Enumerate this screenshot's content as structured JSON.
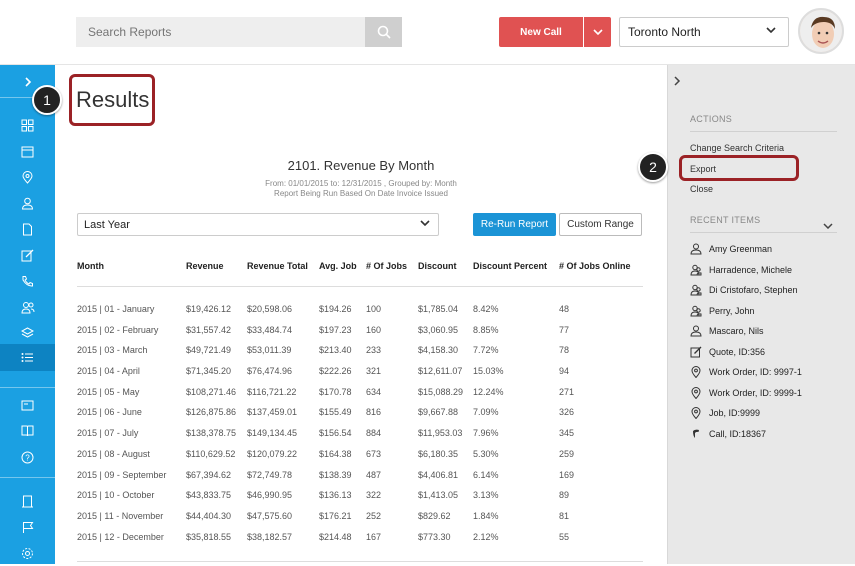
{
  "header": {
    "search_placeholder": "Search Reports",
    "new_call_label": "New Call",
    "location": "Toronto North"
  },
  "sidebar": {
    "icons": [
      "chevron-right-icon",
      "dashboard-icon",
      "calendar-icon",
      "location-pin-icon",
      "user-icon",
      "document-icon",
      "edit-icon",
      "phone-icon",
      "users-icon",
      "layers-icon",
      "list-icon",
      "id-card-icon",
      "book-icon",
      "help-icon",
      "building-icon",
      "flag-icon",
      "gear-icon"
    ]
  },
  "main": {
    "page_title": "Results",
    "callout_1": "1",
    "callout_2": "2",
    "report": {
      "title": "2101. Revenue By Month",
      "subtitle_line1": "From: 01/01/2015 to: 12/31/2015 , Grouped by: Month",
      "subtitle_line2": "Report Being Run Based On Date Invoice Issued"
    },
    "period_value": "Last Year",
    "rerun_label": "Re-Run Report",
    "custom_range_label": "Custom Range",
    "table": {
      "headers": [
        "Month",
        "Revenue",
        "Revenue Total",
        "Avg. Job",
        "# Of Jobs",
        "Discount",
        "Discount Percent",
        "# Of Jobs Online"
      ],
      "rows": [
        [
          "2015 | 01 - January",
          "$19,426.12",
          "$20,598.06",
          "$194.26",
          "100",
          "$1,785.04",
          "8.42%",
          "48"
        ],
        [
          "2015 | 02 - February",
          "$31,557.42",
          "$33,484.74",
          "$197.23",
          "160",
          "$3,060.95",
          "8.85%",
          "77"
        ],
        [
          "2015 | 03 - March",
          "$49,721.49",
          "$53,011.39",
          "$213.40",
          "233",
          "$4,158.30",
          "7.72%",
          "78"
        ],
        [
          "2015 | 04 - April",
          "$71,345.20",
          "$76,474.96",
          "$222.26",
          "321",
          "$12,611.07",
          "15.03%",
          "94"
        ],
        [
          "2015 | 05 - May",
          "$108,271.46",
          "$116,721.22",
          "$170.78",
          "634",
          "$15,088.29",
          "12.24%",
          "271"
        ],
        [
          "2015 | 06 - June",
          "$126,875.86",
          "$137,459.01",
          "$155.49",
          "816",
          "$9,667.88",
          "7.09%",
          "326"
        ],
        [
          "2015 | 07 - July",
          "$138,378.75",
          "$149,134.45",
          "$156.54",
          "884",
          "$11,953.03",
          "7.96%",
          "345"
        ],
        [
          "2015 | 08 - August",
          "$110,629.52",
          "$120,079.22",
          "$164.38",
          "673",
          "$6,180.35",
          "5.30%",
          "259"
        ],
        [
          "2015 | 09 - September",
          "$67,394.62",
          "$72,749.78",
          "$138.39",
          "487",
          "$4,406.81",
          "6.14%",
          "169"
        ],
        [
          "2015 | 10 - October",
          "$43,833.75",
          "$46,990.95",
          "$136.13",
          "322",
          "$1,413.05",
          "3.13%",
          "89"
        ],
        [
          "2015 | 11 - November",
          "$44,404.30",
          "$47,575.60",
          "$176.21",
          "252",
          "$829.62",
          "1.84%",
          "81"
        ],
        [
          "2015 | 12 - December",
          "$35,818.55",
          "$38,182.57",
          "$214.48",
          "167",
          "$773.30",
          "2.12%",
          "55"
        ]
      ]
    }
  },
  "right_panel": {
    "actions_title": "ACTIONS",
    "actions": [
      "Change Search Criteria",
      "Export",
      "Close"
    ],
    "recent_title": "RECENT ITEMS",
    "recent_items": [
      {
        "icon": "user-icon",
        "label": "Amy Greenman"
      },
      {
        "icon": "users-icon",
        "label": "Harradence, Michele"
      },
      {
        "icon": "users-icon",
        "label": "Di Cristofaro, Stephen"
      },
      {
        "icon": "users-icon",
        "label": "Perry, John"
      },
      {
        "icon": "user-icon",
        "label": "Mascaro, Nils"
      },
      {
        "icon": "edit-icon",
        "label": "Quote, ID:356"
      },
      {
        "icon": "location-pin-icon",
        "label": "Work Order, ID: 9997-1"
      },
      {
        "icon": "location-pin-icon",
        "label": "Work Order, ID: 9999-1"
      },
      {
        "icon": "location-pin-icon",
        "label": "Job, ID:9999"
      },
      {
        "icon": "phone-icon",
        "label": "Call, ID:18367"
      }
    ]
  },
  "colors": {
    "sidebar": "#1ba0e2",
    "new_call": "#e05252",
    "rerun": "#1b94d6",
    "callout": "#9b2226"
  }
}
